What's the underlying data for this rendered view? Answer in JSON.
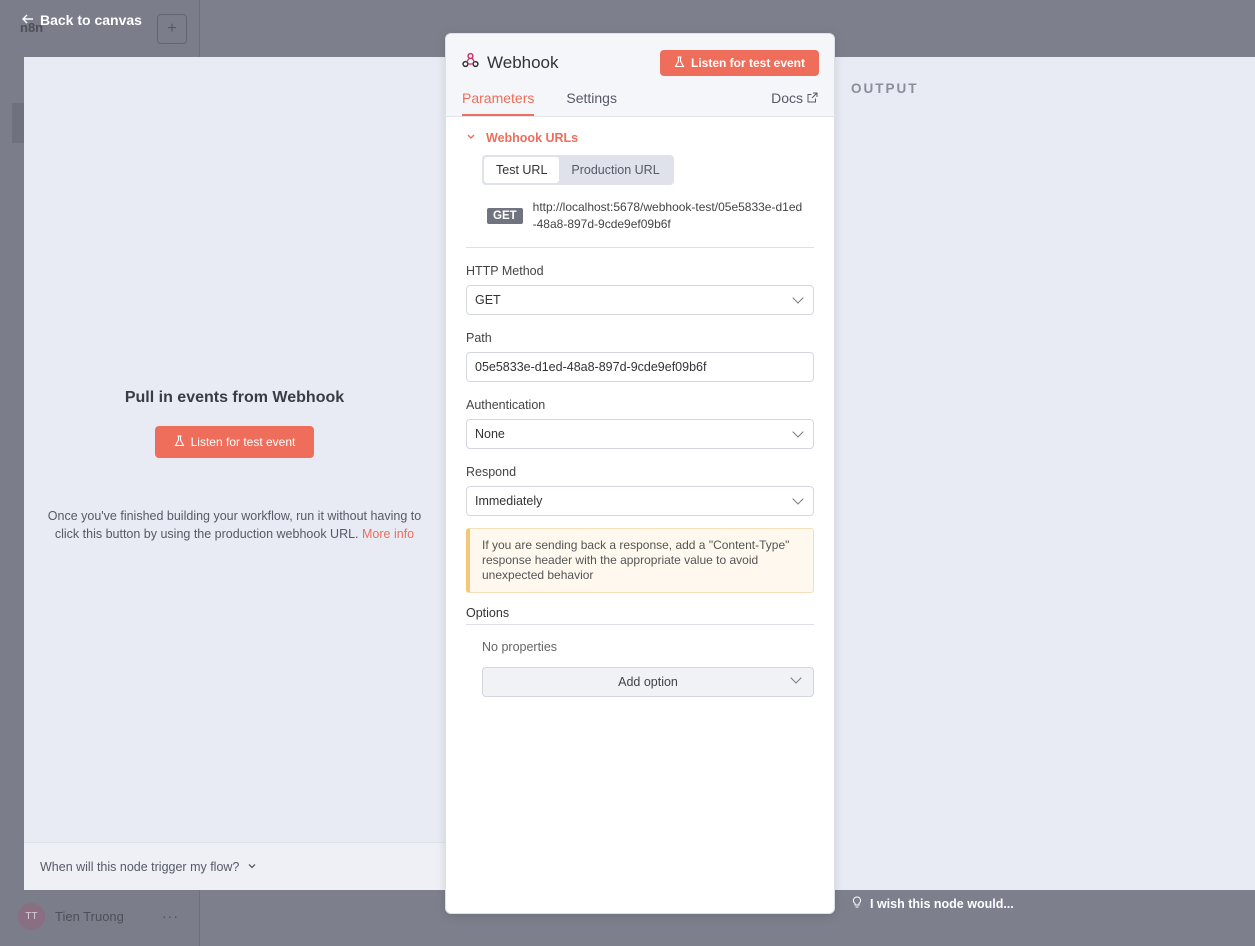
{
  "app": {
    "logo": "n8n",
    "user_initials": "TT",
    "user_name": "Tien Truong",
    "more": "···"
  },
  "nav": {
    "back_label": "Back to canvas"
  },
  "input_pane": {
    "title": "Pull in events from Webhook",
    "listen_label": "Listen for test event",
    "help_text": "Once you've finished building your workflow, run it without having to click this button by using the production webhook URL.",
    "more_info": "More info",
    "trigger_question": "When will this node trigger my flow?"
  },
  "output_pane": {
    "title": "OUTPUT"
  },
  "feedback": {
    "wish": "I wish this node would..."
  },
  "node": {
    "name": "Webhook",
    "listen_label": "Listen for test event",
    "tabs": [
      "Parameters",
      "Settings"
    ],
    "docs": "Docs",
    "webhook_urls": {
      "section_title": "Webhook URLs",
      "toggle": [
        "Test URL",
        "Production URL"
      ],
      "selected": "Test URL",
      "method": "GET",
      "url": "http://localhost:5678/webhook-test/05e5833e-d1ed-48a8-897d-9cde9ef09b6f"
    },
    "fields": {
      "http_method": {
        "label": "HTTP Method",
        "value": "GET"
      },
      "path": {
        "label": "Path",
        "value": "05e5833e-d1ed-48a8-897d-9cde9ef09b6f"
      },
      "authentication": {
        "label": "Authentication",
        "value": "None"
      },
      "respond": {
        "label": "Respond",
        "value": "Immediately"
      }
    },
    "notice": "If you are sending back a response, add a \"Content-Type\" response header with the appropriate value to avoid unexpected behavior",
    "options": {
      "label": "Options",
      "empty": "No properties",
      "add_label": "Add option"
    }
  },
  "colors": {
    "accent": "#ee6e5b",
    "warning_border": "#f3c87a"
  }
}
